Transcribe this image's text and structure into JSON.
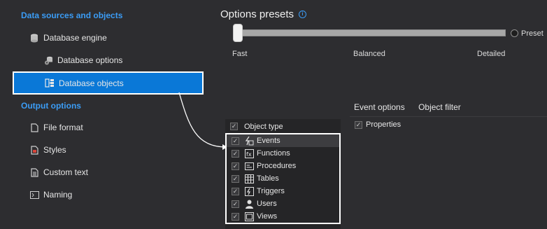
{
  "sidebar": {
    "section1_title": "Data sources and objects",
    "section2_title": "Output options",
    "items": [
      {
        "label": "Database engine",
        "icon": "database-icon"
      },
      {
        "label": "Database options",
        "icon": "database-settings-icon"
      },
      {
        "label": "Database objects",
        "icon": "database-objects-icon",
        "selected": true
      },
      {
        "label": "File format",
        "icon": "file-icon"
      },
      {
        "label": "Styles",
        "icon": "styles-icon"
      },
      {
        "label": "Custom text",
        "icon": "document-text-icon"
      },
      {
        "label": "Naming",
        "icon": "naming-icon"
      }
    ]
  },
  "presets": {
    "title": "Options presets",
    "preset_label": "Preset",
    "levels": [
      "Fast",
      "Balanced",
      "Detailed"
    ],
    "slider_position": 0
  },
  "object_types": {
    "header": "Object type",
    "items": [
      {
        "label": "Events",
        "checked": true,
        "selected": true,
        "icon": "events-icon"
      },
      {
        "label": "Functions",
        "checked": true,
        "icon": "functions-icon"
      },
      {
        "label": "Procedures",
        "checked": true,
        "icon": "procedures-icon"
      },
      {
        "label": "Tables",
        "checked": true,
        "icon": "table-icon"
      },
      {
        "label": "Triggers",
        "checked": true,
        "icon": "triggers-icon"
      },
      {
        "label": "Users",
        "checked": true,
        "icon": "user-icon"
      },
      {
        "label": "Views",
        "checked": true,
        "icon": "views-icon"
      }
    ]
  },
  "event_options": {
    "tabs": [
      "Event options",
      "Object filter"
    ],
    "items": [
      {
        "label": "Properties",
        "checked": true
      }
    ]
  },
  "colors": {
    "background": "#2d2d30",
    "accent": "#3b9cf5",
    "selection": "#0a78d7"
  }
}
